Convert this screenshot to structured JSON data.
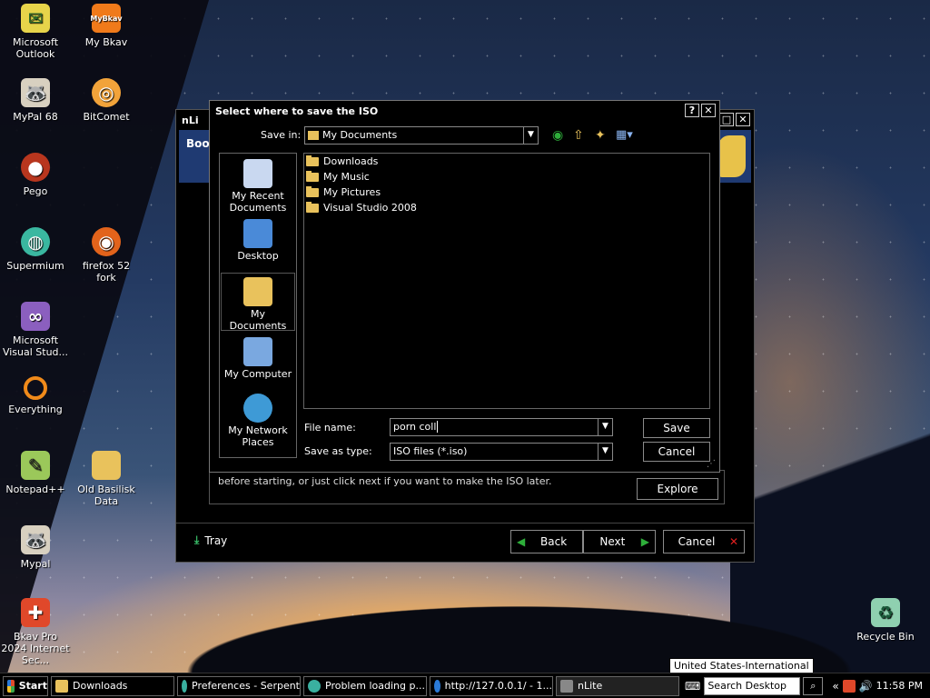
{
  "desktop": {
    "icons": [
      {
        "label": "Microsoft Outlook"
      },
      {
        "label": "My Bkav"
      },
      {
        "label": "MyPal 68"
      },
      {
        "label": "BitComet"
      },
      {
        "label": "Pego"
      },
      {
        "label": "Supermium"
      },
      {
        "label": "firefox 52 fork"
      },
      {
        "label": "Microsoft Visual Stud..."
      },
      {
        "label": "Everything"
      },
      {
        "label": "Notepad++"
      },
      {
        "label": "Old Basilisk Data"
      },
      {
        "label": "Mypal"
      },
      {
        "label": "Bkav Pro 2024 Internet Sec..."
      },
      {
        "label": "Recycle Bin"
      }
    ]
  },
  "nlite": {
    "title": "nLi",
    "header": "Boot",
    "body_text": "before starting, or just click next if you want to make the ISO later.",
    "explore": "Explore",
    "tray": "Tray",
    "back": "Back",
    "next": "Next",
    "cancel": "Cancel"
  },
  "dialog": {
    "title": "Select where to save the ISO",
    "help_btn": "?",
    "close_btn": "✕",
    "save_in_label": "Save in:",
    "save_in_value": "My Documents",
    "places": [
      {
        "label": "My Recent Documents"
      },
      {
        "label": "Desktop"
      },
      {
        "label": "My Documents"
      },
      {
        "label": "My Computer"
      },
      {
        "label": "My Network Places"
      }
    ],
    "files": [
      "Downloads",
      "My Music",
      "My Pictures",
      "Visual Studio 2008"
    ],
    "file_name_label": "File name:",
    "file_name_value": "porn coll",
    "save_type_label": "Save as type:",
    "save_type_value": "ISO files (*.iso)",
    "save": "Save",
    "cancel": "Cancel"
  },
  "tooltip": "United States-International",
  "taskbar": {
    "start": "Start",
    "buttons": [
      "Downloads",
      "Preferences - Serpent",
      "Problem loading p...",
      "http://127.0.0.1/ - 1...",
      "nLite"
    ],
    "search_placeholder": "Search Desktop",
    "clock": "11:58 PM",
    "chevron": "«"
  },
  "colors": {
    "bkav_orange": "#f07a1a",
    "folder": "#e9c25c",
    "next_green": "#2eae3a",
    "cancel_red": "#e02020"
  }
}
